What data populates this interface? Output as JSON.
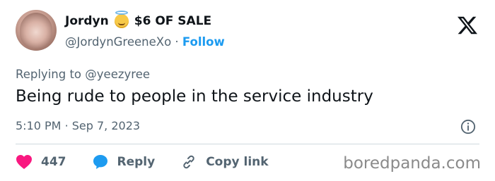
{
  "user": {
    "display_name": "Jordyn",
    "display_suffix": "$6 OF SALE",
    "handle": "@JordynGreeneXo",
    "separator": "·",
    "follow_label": "Follow"
  },
  "tweet": {
    "replying_to_prefix": "Replying to",
    "replying_to_handle": "@yeezyree",
    "text": "Being rude to people in the service industry",
    "time": "5:10 PM",
    "separator": "·",
    "date": "Sep 7, 2023"
  },
  "actions": {
    "like_count": "447",
    "reply_label": "Reply",
    "copy_link_label": "Copy link"
  },
  "watermark": "boredpanda.com",
  "colors": {
    "text": "#0f1419",
    "muted": "#536471",
    "accent": "#1d9bf0",
    "like": "#f91880",
    "divider": "#cfd9de"
  },
  "icons": {
    "emoji": "halo-smiley-icon",
    "brand": "x-logo-icon",
    "info": "info-icon",
    "like": "heart-icon",
    "reply": "speech-bubble-icon",
    "copy": "link-icon"
  }
}
